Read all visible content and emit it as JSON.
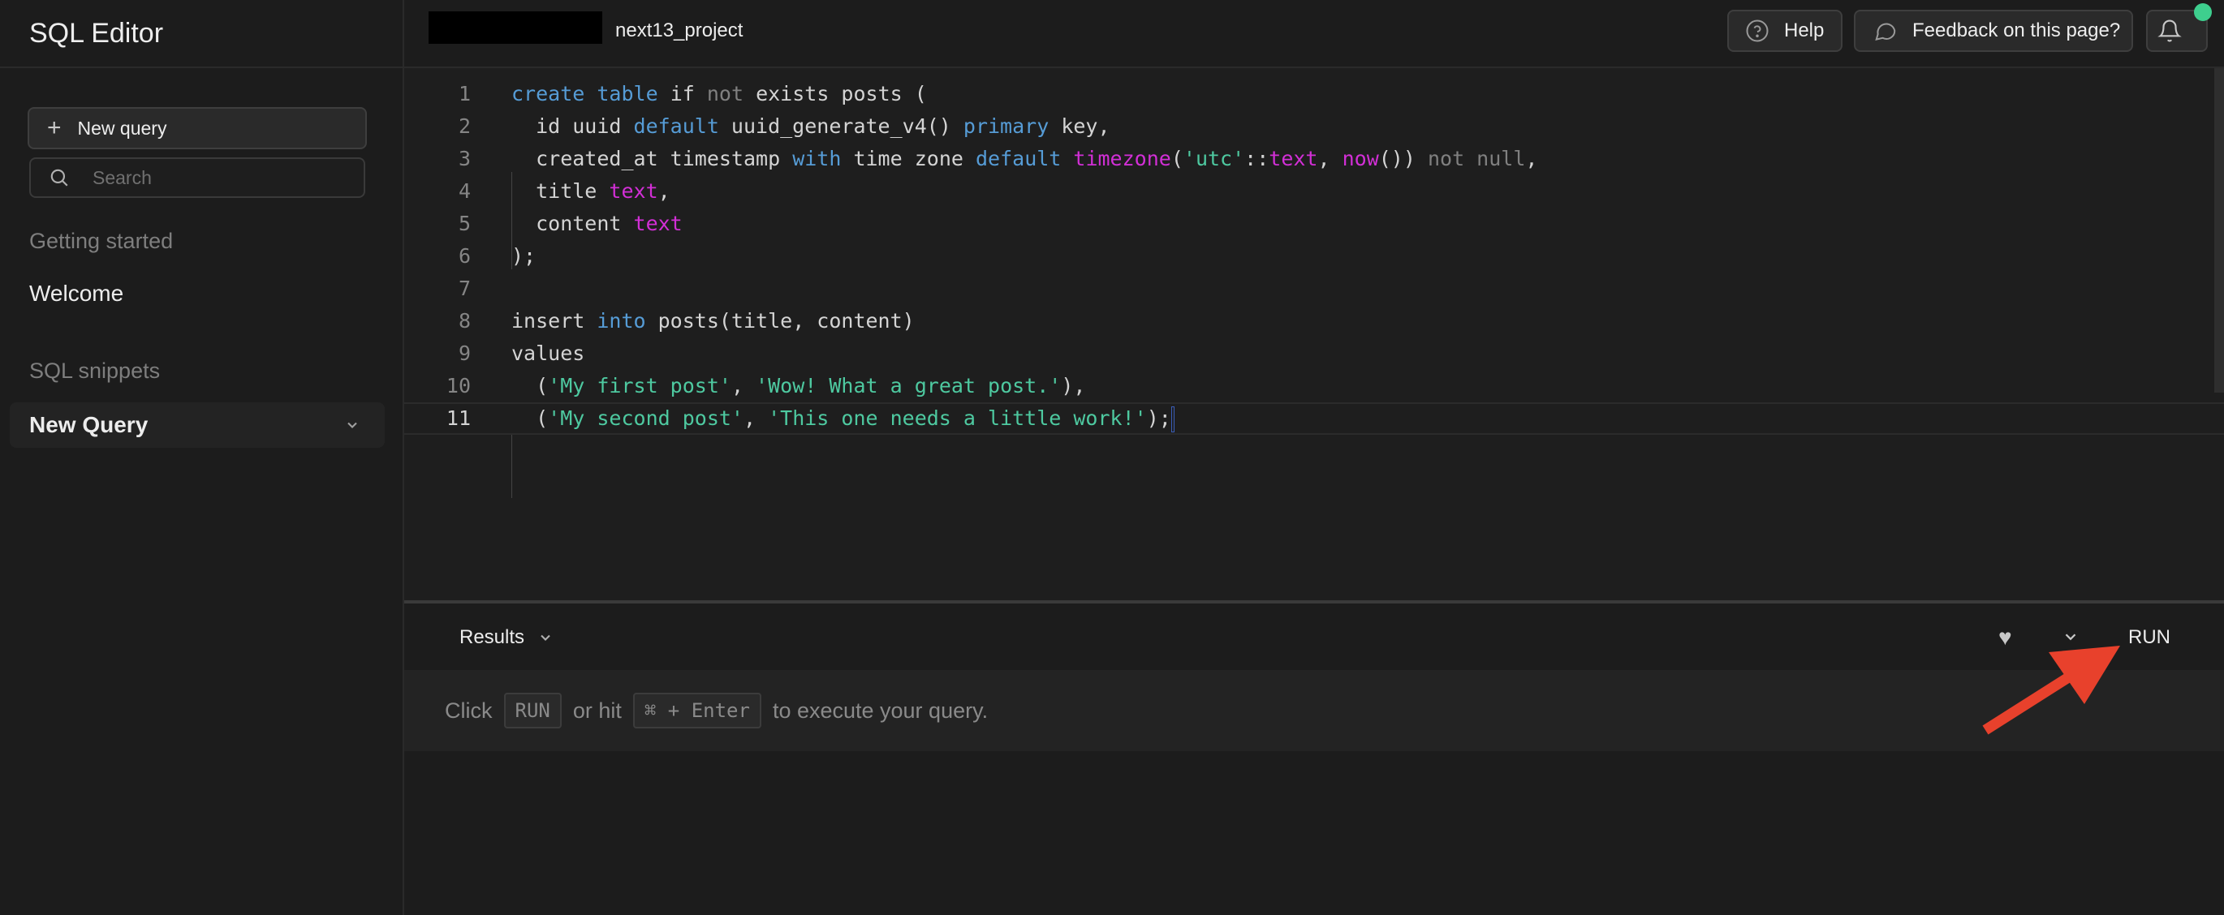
{
  "sidebar": {
    "title": "SQL Editor",
    "new_query": "New query",
    "search_placeholder": "Search",
    "getting_started_label": "Getting started",
    "welcome": "Welcome",
    "snippets_label": "SQL snippets",
    "snippet_item": "New Query"
  },
  "topbar": {
    "project": "next13_project",
    "help": "Help",
    "feedback": "Feedback on this page?"
  },
  "editor": {
    "line_numbers": [
      "1",
      "2",
      "3",
      "4",
      "5",
      "6",
      "7",
      "8",
      "9",
      "10",
      "11"
    ],
    "lines": [
      [
        [
          "kw",
          "create"
        ],
        [
          "p",
          " "
        ],
        [
          "kw",
          "table"
        ],
        [
          "p",
          " if "
        ],
        [
          "kw2",
          "not"
        ],
        [
          "p",
          " exists posts ("
        ]
      ],
      [
        [
          "p",
          "  id uuid "
        ],
        [
          "kw",
          "default"
        ],
        [
          "p",
          " uuid_generate_v4() "
        ],
        [
          "kw",
          "primary"
        ],
        [
          "p",
          " key,"
        ]
      ],
      [
        [
          "p",
          "  created_at timestamp "
        ],
        [
          "kw",
          "with"
        ],
        [
          "p",
          " time zone "
        ],
        [
          "kw",
          "default"
        ],
        [
          "p",
          " "
        ],
        [
          "ty",
          "timezone"
        ],
        [
          "p",
          "("
        ],
        [
          "st",
          "'utc'"
        ],
        [
          "p",
          "::"
        ],
        [
          "ty",
          "text"
        ],
        [
          "p",
          ", "
        ],
        [
          "ty",
          "now"
        ],
        [
          "p",
          "()) "
        ],
        [
          "kw2",
          "not null"
        ],
        [
          "p",
          ","
        ]
      ],
      [
        [
          "p",
          "  title "
        ],
        [
          "ty",
          "text"
        ],
        [
          "p",
          ","
        ]
      ],
      [
        [
          "p",
          "  content "
        ],
        [
          "ty",
          "text"
        ]
      ],
      [
        [
          "p",
          ");"
        ]
      ],
      [],
      [
        [
          "p",
          "insert "
        ],
        [
          "kw",
          "into"
        ],
        [
          "p",
          " posts(title, content)"
        ]
      ],
      [
        [
          "p",
          "values"
        ]
      ],
      [
        [
          "p",
          "  ("
        ],
        [
          "st",
          "'My first post'"
        ],
        [
          "p",
          ", "
        ],
        [
          "st",
          "'Wow! What a great post.'"
        ],
        [
          "p",
          "),"
        ]
      ],
      [
        [
          "p",
          "  ("
        ],
        [
          "st",
          "'My second post'"
        ],
        [
          "p",
          ", "
        ],
        [
          "st",
          "'This one needs a little work!'"
        ],
        [
          "p",
          ");"
        ]
      ]
    ]
  },
  "results": {
    "tab": "Results",
    "run": "RUN",
    "hint_click": "Click",
    "hint_run": "RUN",
    "hint_or": "or hit",
    "hint_keys": "⌘ + Enter",
    "hint_rest": "to execute your query."
  },
  "colors": {
    "accent_green": "#3ecf8e",
    "keyword": "#569cd6",
    "type": "#d22fd6",
    "string": "#4ec9a0",
    "annotation_arrow": "#e8412c"
  }
}
